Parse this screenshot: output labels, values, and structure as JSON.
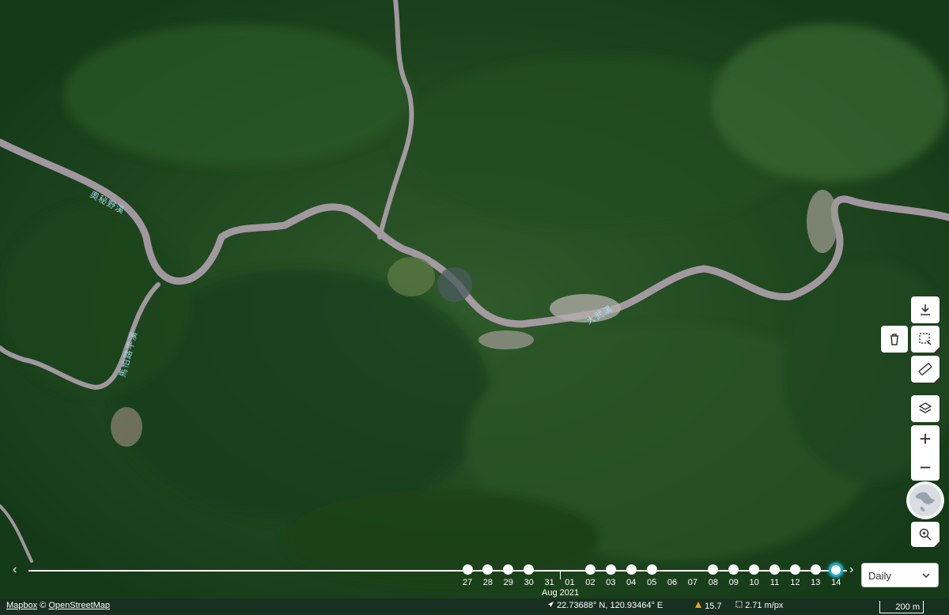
{
  "map": {
    "labels": [
      "奧秘野溪",
      "馬怕路平溪",
      "大武溪"
    ]
  },
  "controls": {
    "download": "download-icon",
    "delete": "trash-icon",
    "select_area": "select-area-icon",
    "measure": "ruler-icon",
    "layers": "layers-icon",
    "zoom_in": "+",
    "zoom_out": "−",
    "globe": "globe-icon",
    "search_zoom": "zoom-search-icon"
  },
  "timeline": {
    "prev": "‹",
    "next": "›",
    "days": [
      "27",
      "28",
      "29",
      "30",
      "31",
      "01",
      "02",
      "03",
      "04",
      "05",
      "06",
      "07",
      "08",
      "09",
      "10",
      "11",
      "12",
      "13",
      "14"
    ],
    "has_dot": [
      true,
      true,
      true,
      true,
      false,
      false,
      true,
      true,
      true,
      true,
      false,
      false,
      true,
      true,
      true,
      true,
      true,
      true,
      true
    ],
    "active_day": "14",
    "month_label": "Aug 2021"
  },
  "interval_select": {
    "value": "Daily"
  },
  "footer": {
    "attribution_mapbox": "Mapbox",
    "copyright": "©",
    "attribution_osm": "OpenStreetMap",
    "coordinates": "22.73688° N, 120.93464° E",
    "elevation": "15.7",
    "resolution": "2.71 m/px",
    "scale": "200 m"
  },
  "colors": {
    "accent": "#1aa9c9",
    "footer_bg": "#173020",
    "forest": "#1f4a22",
    "river": "#b8a9b4"
  }
}
